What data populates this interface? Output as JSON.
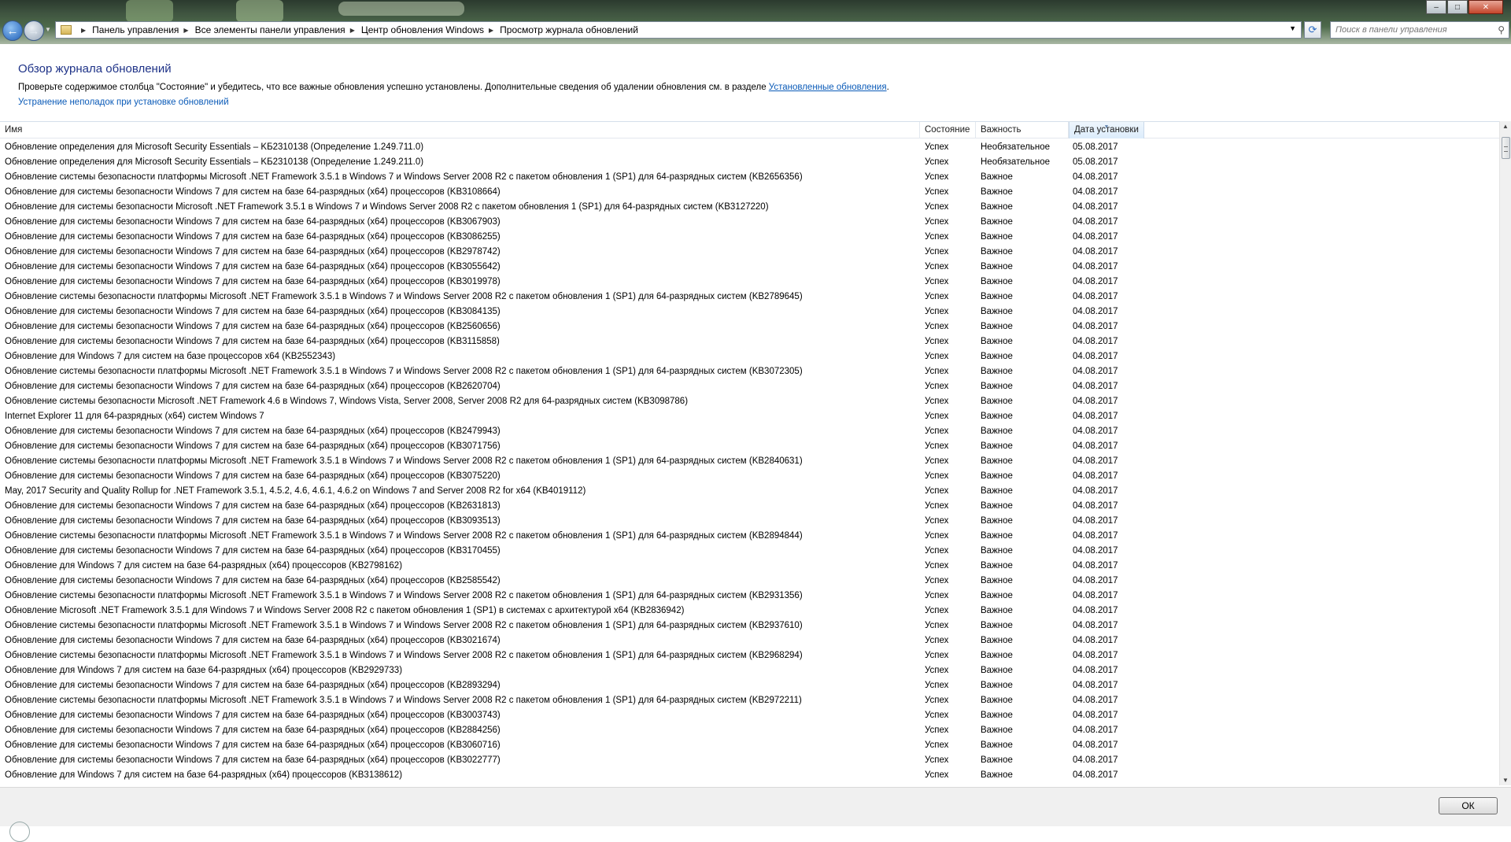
{
  "window": {
    "controls": {
      "minimize": "‒",
      "maximize": "□",
      "close": "✕"
    }
  },
  "address": {
    "breadcrumbs": [
      "Панель управления",
      "Все элементы панели управления",
      "Центр обновления Windows",
      "Просмотр журнала обновлений"
    ]
  },
  "search": {
    "placeholder": "Поиск в панели управления"
  },
  "header": {
    "title": "Обзор журнала обновлений",
    "description": "Проверьте содержимое столбца \"Состояние\" и убедитесь, что все важные обновления успешно установлены. Дополнительные сведения об удалении обновления см. в разделе ",
    "installed_link": "Установленные обновления",
    "description_end": ".",
    "troubleshoot_link": "Устранение неполадок при установке обновлений"
  },
  "table": {
    "columns": {
      "name": "Имя",
      "status": "Состояние",
      "importance": "Важность",
      "date": "Дата установки"
    },
    "sorted_column": "date",
    "rows": [
      {
        "name": "Обновление определения для Microsoft Security Essentials – KБ2310138 (Определение 1.249.711.0)",
        "status": "Успех",
        "importance": "Необязательное",
        "date": "05.08.2017"
      },
      {
        "name": "Обновление определения для Microsoft Security Essentials – KБ2310138 (Определение 1.249.211.0)",
        "status": "Успех",
        "importance": "Необязательное",
        "date": "05.08.2017"
      },
      {
        "name": "Обновление системы безопасности платформы Microsoft .NET Framework 3.5.1 в Windows 7 и Windows Server 2008 R2 с пакетом обновления 1 (SP1) для 64-разрядных систем (KB2656356)",
        "status": "Успех",
        "importance": "Важное",
        "date": "04.08.2017"
      },
      {
        "name": "Обновление для системы безопасности Windows 7 для систем на базе 64-разрядных (x64) процессоров (KB3108664)",
        "status": "Успех",
        "importance": "Важное",
        "date": "04.08.2017"
      },
      {
        "name": "Обновление для системы безопасности Microsoft .NET Framework 3.5.1 в Windows 7 и Windows Server 2008 R2 с пакетом обновления 1 (SP1) для 64-разрядных систем (KB3127220)",
        "status": "Успех",
        "importance": "Важное",
        "date": "04.08.2017"
      },
      {
        "name": "Обновление для системы безопасности Windows 7 для систем на базе 64-разрядных (x64) процессоров (KB3067903)",
        "status": "Успех",
        "importance": "Важное",
        "date": "04.08.2017"
      },
      {
        "name": "Обновление для системы безопасности Windows 7 для систем на базе 64-разрядных (x64) процессоров (KB3086255)",
        "status": "Успех",
        "importance": "Важное",
        "date": "04.08.2017"
      },
      {
        "name": "Обновление для системы безопасности Windows 7 для систем на базе 64-разрядных (x64) процессоров (KB2978742)",
        "status": "Успех",
        "importance": "Важное",
        "date": "04.08.2017"
      },
      {
        "name": "Обновление для системы безопасности Windows 7 для систем на базе 64-разрядных (x64) процессоров (KB3055642)",
        "status": "Успех",
        "importance": "Важное",
        "date": "04.08.2017"
      },
      {
        "name": "Обновление для системы безопасности Windows 7 для систем на базе 64-разрядных (x64) процессоров (KB3019978)",
        "status": "Успех",
        "importance": "Важное",
        "date": "04.08.2017"
      },
      {
        "name": "Обновление системы безопасности платформы Microsoft .NET Framework 3.5.1 в Windows 7 и Windows Server 2008 R2 с пакетом обновления 1 (SP1) для 64-разрядных систем (KB2789645)",
        "status": "Успех",
        "importance": "Важное",
        "date": "04.08.2017"
      },
      {
        "name": "Обновление для системы безопасности Windows 7 для систем на базе 64-разрядных (x64) процессоров (KB3084135)",
        "status": "Успех",
        "importance": "Важное",
        "date": "04.08.2017"
      },
      {
        "name": "Обновление для системы безопасности Windows 7 для систем на базе 64-разрядных (x64) процессоров (KB2560656)",
        "status": "Успех",
        "importance": "Важное",
        "date": "04.08.2017"
      },
      {
        "name": "Обновление для системы безопасности Windows 7 для систем на базе 64-разрядных (x64) процессоров (KB3115858)",
        "status": "Успех",
        "importance": "Важное",
        "date": "04.08.2017"
      },
      {
        "name": "Обновление для Windows 7 для систем на базе процессоров x64 (KB2552343)",
        "status": "Успех",
        "importance": "Важное",
        "date": "04.08.2017"
      },
      {
        "name": "Обновление системы безопасности платформы Microsoft .NET Framework 3.5.1 в Windows 7 и Windows Server 2008 R2 с пакетом обновления 1 (SP1) для 64-разрядных систем (KB3072305)",
        "status": "Успех",
        "importance": "Важное",
        "date": "04.08.2017"
      },
      {
        "name": "Обновление для системы безопасности Windows 7 для систем на базе 64-разрядных (x64) процессоров (KB2620704)",
        "status": "Успех",
        "importance": "Важное",
        "date": "04.08.2017"
      },
      {
        "name": "Обновление системы безопасности Microsoft .NET Framework 4.6 в Windows 7, Windows Vista, Server 2008, Server 2008 R2 для 64-разрядных систем (KB3098786)",
        "status": "Успех",
        "importance": "Важное",
        "date": "04.08.2017"
      },
      {
        "name": "Internet Explorer 11 для 64-разрядных (x64) систем Windows 7",
        "status": "Успех",
        "importance": "Важное",
        "date": "04.08.2017"
      },
      {
        "name": "Обновление для системы безопасности Windows 7 для систем на базе 64-разрядных (x64) процессоров (KB2479943)",
        "status": "Успех",
        "importance": "Важное",
        "date": "04.08.2017"
      },
      {
        "name": "Обновление для системы безопасности Windows 7 для систем на базе 64-разрядных (x64) процессоров (KB3071756)",
        "status": "Успех",
        "importance": "Важное",
        "date": "04.08.2017"
      },
      {
        "name": "Обновление системы безопасности платформы Microsoft .NET Framework 3.5.1 в Windows 7 и Windows Server 2008 R2 с пакетом обновления 1 (SP1) для 64-разрядных систем (KB2840631)",
        "status": "Успех",
        "importance": "Важное",
        "date": "04.08.2017"
      },
      {
        "name": "Обновление для системы безопасности Windows 7 для систем на базе 64-разрядных (x64) процессоров (KB3075220)",
        "status": "Успех",
        "importance": "Важное",
        "date": "04.08.2017"
      },
      {
        "name": "May, 2017 Security and Quality Rollup for .NET Framework 3.5.1, 4.5.2, 4.6, 4.6.1, 4.6.2 on Windows 7 and Server 2008 R2 for x64 (KB4019112)",
        "status": "Успех",
        "importance": "Важное",
        "date": "04.08.2017"
      },
      {
        "name": "Обновление для системы безопасности Windows 7 для систем на базе 64-разрядных (x64) процессоров (KB2631813)",
        "status": "Успех",
        "importance": "Важное",
        "date": "04.08.2017"
      },
      {
        "name": "Обновление для системы безопасности Windows 7 для систем на базе 64-разрядных (x64) процессоров (KB3093513)",
        "status": "Успех",
        "importance": "Важное",
        "date": "04.08.2017"
      },
      {
        "name": "Обновление системы безопасности платформы Microsoft .NET Framework 3.5.1 в Windows 7 и Windows Server 2008 R2 с пакетом обновления 1 (SP1) для 64-разрядных систем (KB2894844)",
        "status": "Успех",
        "importance": "Важное",
        "date": "04.08.2017"
      },
      {
        "name": "Обновление для системы безопасности Windows 7 для систем на базе 64-разрядных (x64) процессоров (KB3170455)",
        "status": "Успех",
        "importance": "Важное",
        "date": "04.08.2017"
      },
      {
        "name": "Обновление для Windows 7 для систем на базе 64-разрядных (x64) процессоров (KB2798162)",
        "status": "Успех",
        "importance": "Важное",
        "date": "04.08.2017"
      },
      {
        "name": "Обновление для системы безопасности Windows 7 для систем на базе 64-разрядных (x64) процессоров (KB2585542)",
        "status": "Успех",
        "importance": "Важное",
        "date": "04.08.2017"
      },
      {
        "name": "Обновление системы безопасности платформы Microsoft .NET Framework 3.5.1 в Windows 7 и Windows Server 2008 R2 с пакетом обновления 1 (SP1) для 64-разрядных систем (KB2931356)",
        "status": "Успех",
        "importance": "Важное",
        "date": "04.08.2017"
      },
      {
        "name": "Обновление Microsoft .NET Framework 3.5.1 для Windows 7 и Windows Server 2008 R2 с пакетом обновления 1 (SP1) в системах с архитектурой x64 (KB2836942)",
        "status": "Успех",
        "importance": "Важное",
        "date": "04.08.2017"
      },
      {
        "name": "Обновление системы безопасности платформы Microsoft .NET Framework 3.5.1 в Windows 7 и Windows Server 2008 R2 с пакетом обновления 1 (SP1) для 64-разрядных систем (KB2937610)",
        "status": "Успех",
        "importance": "Важное",
        "date": "04.08.2017"
      },
      {
        "name": "Обновление для системы безопасности Windows 7 для систем на базе 64-разрядных (x64) процессоров (KB3021674)",
        "status": "Успех",
        "importance": "Важное",
        "date": "04.08.2017"
      },
      {
        "name": "Обновление системы безопасности платформы Microsoft .NET Framework 3.5.1 в Windows 7 и Windows Server 2008 R2 с пакетом обновления 1 (SP1) для 64-разрядных систем (KB2968294)",
        "status": "Успех",
        "importance": "Важное",
        "date": "04.08.2017"
      },
      {
        "name": "Обновление для Windows 7 для систем на базе 64-разрядных (x64) процессоров (KB2929733)",
        "status": "Успех",
        "importance": "Важное",
        "date": "04.08.2017"
      },
      {
        "name": "Обновление для системы безопасности Windows 7 для систем на базе 64-разрядных (x64) процессоров (KB2893294)",
        "status": "Успех",
        "importance": "Важное",
        "date": "04.08.2017"
      },
      {
        "name": "Обновление системы безопасности платформы Microsoft .NET Framework 3.5.1 в Windows 7 и Windows Server 2008 R2 с пакетом обновления 1 (SP1) для 64-разрядных систем (KB2972211)",
        "status": "Успех",
        "importance": "Важное",
        "date": "04.08.2017"
      },
      {
        "name": "Обновление для системы безопасности Windows 7 для систем на базе 64-разрядных (x64) процессоров (KB3003743)",
        "status": "Успех",
        "importance": "Важное",
        "date": "04.08.2017"
      },
      {
        "name": "Обновление для системы безопасности Windows 7 для систем на базе 64-разрядных (x64) процессоров (KB2884256)",
        "status": "Успех",
        "importance": "Важное",
        "date": "04.08.2017"
      },
      {
        "name": "Обновление для системы безопасности Windows 7 для систем на базе 64-разрядных (x64) процессоров (KB3060716)",
        "status": "Успех",
        "importance": "Важное",
        "date": "04.08.2017"
      },
      {
        "name": "Обновление для системы безопасности Windows 7 для систем на базе 64-разрядных (x64) процессоров (KB3022777)",
        "status": "Успех",
        "importance": "Важное",
        "date": "04.08.2017"
      },
      {
        "name": "Обновление для Windows 7 для систем на базе 64-разрядных (x64) процессоров (KB3138612)",
        "status": "Успех",
        "importance": "Важное",
        "date": "04.08.2017"
      }
    ]
  },
  "footer": {
    "ok_label": "ОК"
  }
}
